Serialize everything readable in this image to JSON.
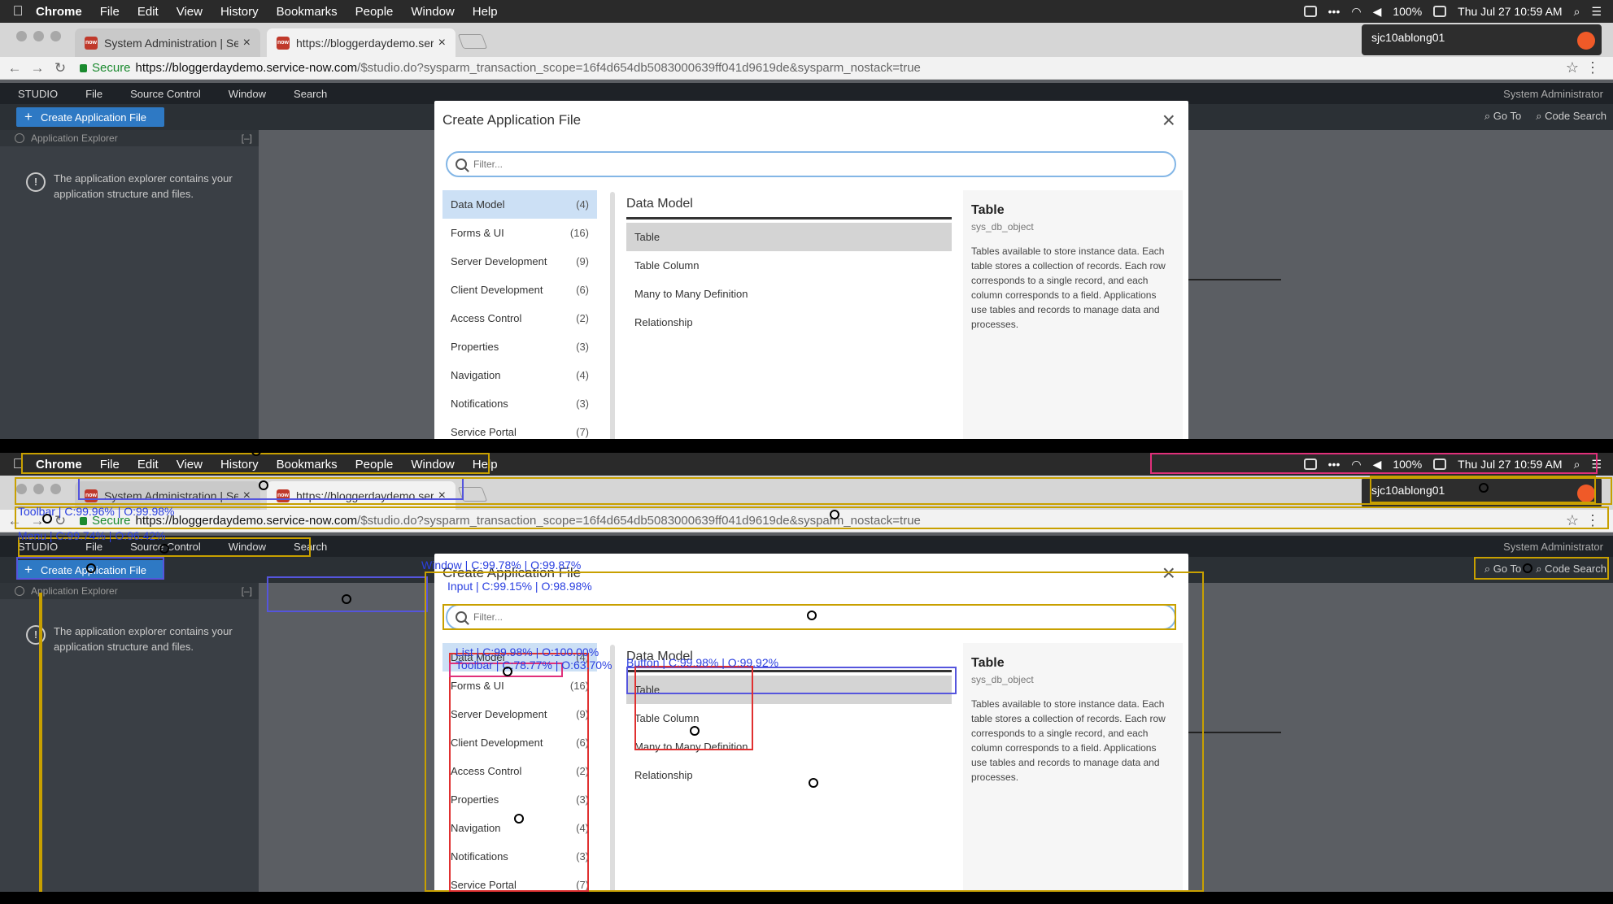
{
  "menubar": {
    "app": "Chrome",
    "items": [
      "File",
      "Edit",
      "View",
      "History",
      "Bookmarks",
      "People",
      "Window",
      "Help"
    ],
    "battery": "100%",
    "clock": "Thu Jul 27  10:59 AM"
  },
  "tabs": [
    {
      "title": "System Administration | Servic"
    },
    {
      "title": "https://bloggerdaydemo.servi"
    }
  ],
  "profile": {
    "name": "sjc10ablong01"
  },
  "address": {
    "secure": "Secure",
    "host": "https://bloggerdaydemo.service-now.com",
    "path": "/$studio.do?sysparm_transaction_scope=16f4d654db5083000639ff041d9619de&sysparm_nostack=true"
  },
  "studio": {
    "menu": [
      "STUDIO",
      "File",
      "Source Control",
      "Window",
      "Search"
    ],
    "user": "System Administrator",
    "create_button": "Create Application File",
    "goto": "Go To",
    "code_search": "Code Search",
    "explorer_title": "Application Explorer",
    "explorer_collapse": "[–]",
    "explorer_info": "The application explorer contains your application structure and files."
  },
  "modal": {
    "title": "Create Application File",
    "filter_placeholder": "Filter...",
    "categories": [
      {
        "label": "Data Model",
        "count": "(4)"
      },
      {
        "label": "Forms & UI",
        "count": "(16)"
      },
      {
        "label": "Server Development",
        "count": "(9)"
      },
      {
        "label": "Client Development",
        "count": "(6)"
      },
      {
        "label": "Access Control",
        "count": "(2)"
      },
      {
        "label": "Properties",
        "count": "(3)"
      },
      {
        "label": "Navigation",
        "count": "(4)"
      },
      {
        "label": "Notifications",
        "count": "(3)"
      },
      {
        "label": "Service Portal",
        "count": "(7)"
      }
    ],
    "section_title": "Data Model",
    "items": [
      "Table",
      "Table Column",
      "Many to Many Definition",
      "Relationship"
    ],
    "detail": {
      "title": "Table",
      "subtitle": "sys_db_object",
      "text": "Tables available to store instance data. Each table stores a collection of records. Each row corresponds to a single record, and each column corresponds to a field. Applications use tables and records to manage data and processes."
    }
  },
  "annotations": {
    "window": "Window | C:99.78% | O:99.87%",
    "input": "Input | C:99.15% | O:98.98%",
    "list": "List | C:99.98% | O:100.00%",
    "toolbar_mod": "Toolbar | C:78.77% | O:63.70%",
    "button_mod": "Button | C:99.98% | O:99.92%",
    "toolbar_top": "Toolbar | C:99.96% | O:99.98%",
    "menu": "Menu | C:99.74% | O:96.42%"
  },
  "colors": {
    "accent": "#2e79c4",
    "selected_category": "#cce0f5",
    "annotation_yellow": "#c8a000",
    "annotation_red": "#e03030",
    "annotation_blue": "#2a3fe0"
  }
}
